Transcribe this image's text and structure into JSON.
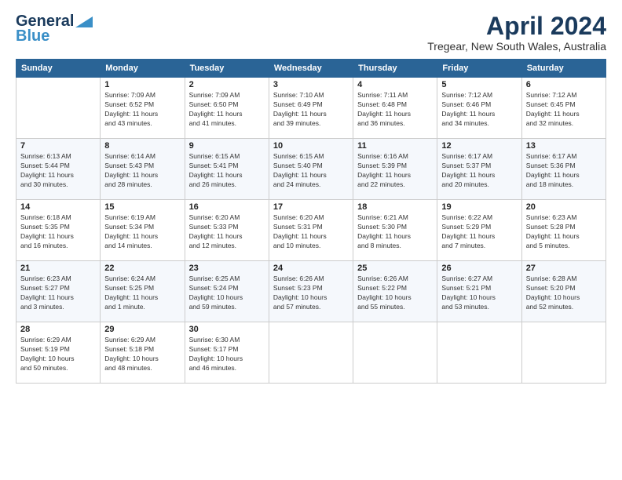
{
  "logo": {
    "line1": "General",
    "line2": "Blue"
  },
  "title": "April 2024",
  "location": "Tregear, New South Wales, Australia",
  "weekdays": [
    "Sunday",
    "Monday",
    "Tuesday",
    "Wednesday",
    "Thursday",
    "Friday",
    "Saturday"
  ],
  "weeks": [
    [
      {
        "day": "",
        "info": ""
      },
      {
        "day": "1",
        "info": "Sunrise: 7:09 AM\nSunset: 6:52 PM\nDaylight: 11 hours\nand 43 minutes."
      },
      {
        "day": "2",
        "info": "Sunrise: 7:09 AM\nSunset: 6:50 PM\nDaylight: 11 hours\nand 41 minutes."
      },
      {
        "day": "3",
        "info": "Sunrise: 7:10 AM\nSunset: 6:49 PM\nDaylight: 11 hours\nand 39 minutes."
      },
      {
        "day": "4",
        "info": "Sunrise: 7:11 AM\nSunset: 6:48 PM\nDaylight: 11 hours\nand 36 minutes."
      },
      {
        "day": "5",
        "info": "Sunrise: 7:12 AM\nSunset: 6:46 PM\nDaylight: 11 hours\nand 34 minutes."
      },
      {
        "day": "6",
        "info": "Sunrise: 7:12 AM\nSunset: 6:45 PM\nDaylight: 11 hours\nand 32 minutes."
      }
    ],
    [
      {
        "day": "7",
        "info": "Sunrise: 6:13 AM\nSunset: 5:44 PM\nDaylight: 11 hours\nand 30 minutes."
      },
      {
        "day": "8",
        "info": "Sunrise: 6:14 AM\nSunset: 5:43 PM\nDaylight: 11 hours\nand 28 minutes."
      },
      {
        "day": "9",
        "info": "Sunrise: 6:15 AM\nSunset: 5:41 PM\nDaylight: 11 hours\nand 26 minutes."
      },
      {
        "day": "10",
        "info": "Sunrise: 6:15 AM\nSunset: 5:40 PM\nDaylight: 11 hours\nand 24 minutes."
      },
      {
        "day": "11",
        "info": "Sunrise: 6:16 AM\nSunset: 5:39 PM\nDaylight: 11 hours\nand 22 minutes."
      },
      {
        "day": "12",
        "info": "Sunrise: 6:17 AM\nSunset: 5:37 PM\nDaylight: 11 hours\nand 20 minutes."
      },
      {
        "day": "13",
        "info": "Sunrise: 6:17 AM\nSunset: 5:36 PM\nDaylight: 11 hours\nand 18 minutes."
      }
    ],
    [
      {
        "day": "14",
        "info": "Sunrise: 6:18 AM\nSunset: 5:35 PM\nDaylight: 11 hours\nand 16 minutes."
      },
      {
        "day": "15",
        "info": "Sunrise: 6:19 AM\nSunset: 5:34 PM\nDaylight: 11 hours\nand 14 minutes."
      },
      {
        "day": "16",
        "info": "Sunrise: 6:20 AM\nSunset: 5:33 PM\nDaylight: 11 hours\nand 12 minutes."
      },
      {
        "day": "17",
        "info": "Sunrise: 6:20 AM\nSunset: 5:31 PM\nDaylight: 11 hours\nand 10 minutes."
      },
      {
        "day": "18",
        "info": "Sunrise: 6:21 AM\nSunset: 5:30 PM\nDaylight: 11 hours\nand 8 minutes."
      },
      {
        "day": "19",
        "info": "Sunrise: 6:22 AM\nSunset: 5:29 PM\nDaylight: 11 hours\nand 7 minutes."
      },
      {
        "day": "20",
        "info": "Sunrise: 6:23 AM\nSunset: 5:28 PM\nDaylight: 11 hours\nand 5 minutes."
      }
    ],
    [
      {
        "day": "21",
        "info": "Sunrise: 6:23 AM\nSunset: 5:27 PM\nDaylight: 11 hours\nand 3 minutes."
      },
      {
        "day": "22",
        "info": "Sunrise: 6:24 AM\nSunset: 5:25 PM\nDaylight: 11 hours\nand 1 minute."
      },
      {
        "day": "23",
        "info": "Sunrise: 6:25 AM\nSunset: 5:24 PM\nDaylight: 10 hours\nand 59 minutes."
      },
      {
        "day": "24",
        "info": "Sunrise: 6:26 AM\nSunset: 5:23 PM\nDaylight: 10 hours\nand 57 minutes."
      },
      {
        "day": "25",
        "info": "Sunrise: 6:26 AM\nSunset: 5:22 PM\nDaylight: 10 hours\nand 55 minutes."
      },
      {
        "day": "26",
        "info": "Sunrise: 6:27 AM\nSunset: 5:21 PM\nDaylight: 10 hours\nand 53 minutes."
      },
      {
        "day": "27",
        "info": "Sunrise: 6:28 AM\nSunset: 5:20 PM\nDaylight: 10 hours\nand 52 minutes."
      }
    ],
    [
      {
        "day": "28",
        "info": "Sunrise: 6:29 AM\nSunset: 5:19 PM\nDaylight: 10 hours\nand 50 minutes."
      },
      {
        "day": "29",
        "info": "Sunrise: 6:29 AM\nSunset: 5:18 PM\nDaylight: 10 hours\nand 48 minutes."
      },
      {
        "day": "30",
        "info": "Sunrise: 6:30 AM\nSunset: 5:17 PM\nDaylight: 10 hours\nand 46 minutes."
      },
      {
        "day": "",
        "info": ""
      },
      {
        "day": "",
        "info": ""
      },
      {
        "day": "",
        "info": ""
      },
      {
        "day": "",
        "info": ""
      }
    ]
  ]
}
